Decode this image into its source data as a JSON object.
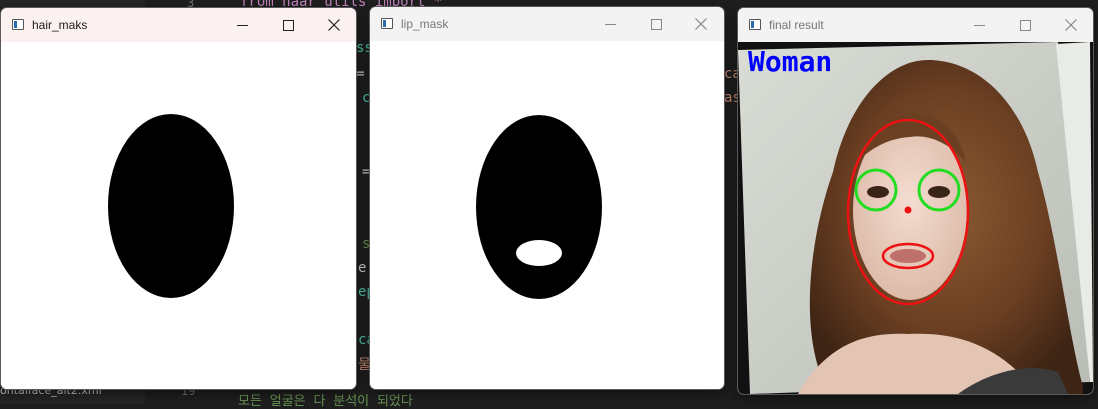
{
  "editor": {
    "code_line_top": "from haar_utils import *",
    "code_frags": [
      "ss",
      "=",
      "c",
      "=",
      "ca",
      "as",
      "s",
      "e:",
      "ep",
      "ca",
      "물"
    ],
    "line_numbers": [
      "3",
      "19"
    ],
    "side_file": "ontalface_alt2.xml",
    "bottom_text": "모든 얼굴은 다 분석이 되었다"
  },
  "windows": [
    {
      "title": "hair_maks",
      "icon": "window-app-icon",
      "controls": {
        "minimize": "minimize-icon",
        "maximize": "maximize-icon",
        "close": "close-icon"
      },
      "active": true
    },
    {
      "title": "lip_mask",
      "icon": "window-app-icon",
      "controls": {
        "minimize": "minimize-icon",
        "maximize": "maximize-icon",
        "close": "close-icon"
      },
      "active": false
    },
    {
      "title": "final result",
      "icon": "window-app-icon",
      "controls": {
        "minimize": "minimize-icon",
        "maximize": "maximize-icon",
        "close": "close-icon"
      },
      "active": false
    }
  ],
  "final_result": {
    "label": "Woman",
    "label_color": "#0000ff",
    "face_ellipse_color": "#ee1111",
    "eye_circle_color": "#22dd22",
    "lip_ellipse_color": "#ee1111",
    "center_dot_color": "#ee1111"
  },
  "colors": {
    "titlebar_active": "#fbf1f0",
    "titlebar_inactive": "#f3f3f3",
    "mask_fill": "#000000",
    "mask_bg": "#ffffff"
  }
}
